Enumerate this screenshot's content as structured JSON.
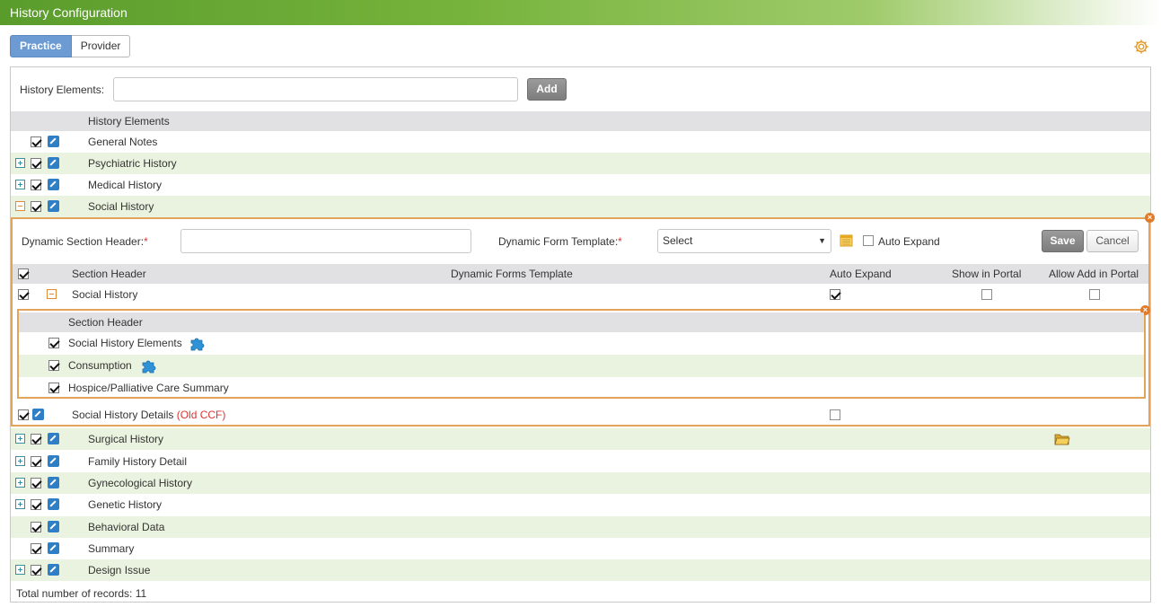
{
  "window": {
    "title": "History Configuration"
  },
  "tabs": [
    {
      "label": "Practice",
      "active": true
    },
    {
      "label": "Provider",
      "active": false
    }
  ],
  "toolbar": {
    "history_elements_label": "History Elements:",
    "history_elements_value": "",
    "add_label": "Add"
  },
  "table": {
    "header": "History Elements",
    "rows": [
      {
        "label": "General Notes",
        "checked": true,
        "expand": "none"
      },
      {
        "label": "Psychiatric History",
        "checked": true,
        "expand": "plus"
      },
      {
        "label": "Medical History",
        "checked": true,
        "expand": "plus"
      },
      {
        "label": "Social History",
        "checked": true,
        "expand": "minus"
      },
      {
        "label": "Surgical History",
        "checked": true,
        "expand": "plus"
      },
      {
        "label": "Family History Detail",
        "checked": true,
        "expand": "plus"
      },
      {
        "label": "Gynecological History",
        "checked": true,
        "expand": "plus"
      },
      {
        "label": "Genetic History",
        "checked": true,
        "expand": "plus"
      },
      {
        "label": "Behavioral Data",
        "checked": true,
        "expand": "none"
      },
      {
        "label": "Summary",
        "checked": true,
        "expand": "none"
      },
      {
        "label": "Design Issue",
        "checked": true,
        "expand": "plus"
      }
    ]
  },
  "social": {
    "dyn_header_label": "Dynamic Section Header:",
    "dyn_header_value": "",
    "required_mark": "*",
    "template_label": "Dynamic Form Template:",
    "template_selected": "Select",
    "auto_expand_label": "Auto Expand",
    "save_label": "Save",
    "cancel_label": "Cancel",
    "columns": {
      "section_header": "Section Header",
      "dynamic_forms_template": "Dynamic Forms Template",
      "auto_expand": "Auto Expand",
      "show_in_portal": "Show in Portal",
      "allow_add_in_portal": "Allow Add in Portal"
    },
    "section_row": {
      "label": "Social History"
    },
    "inner": {
      "header": "Section Header",
      "items": [
        {
          "label": "Social History Elements"
        },
        {
          "label": "Consumption"
        },
        {
          "label": "Hospice/Palliative Care Summary"
        }
      ]
    },
    "details_row": {
      "label": "Social History Details",
      "tag": "(Old CCF)"
    }
  },
  "footer": {
    "total": "Total number of records: 11"
  },
  "colors": {
    "title_green": "#76b33c",
    "tab_active": "#6b9bd2",
    "alt_row": "#eaf3df",
    "orange_border": "#e3a35b",
    "edit_blue": "#2f7fc6"
  }
}
